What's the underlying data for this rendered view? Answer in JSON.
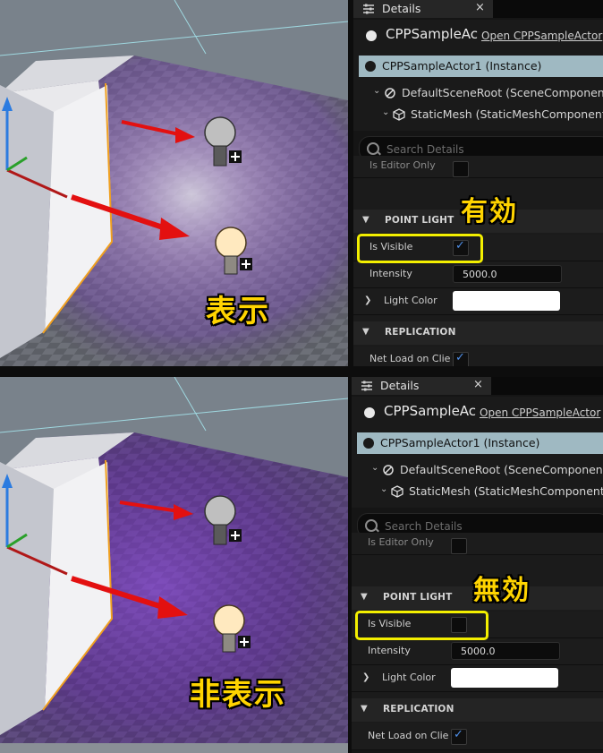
{
  "top": {
    "viewport_annotation": "表示",
    "panel_annotation": "有効",
    "light_bright": true
  },
  "bottom": {
    "viewport_annotation": "非表示",
    "panel_annotation": "無効",
    "light_bright": false
  },
  "details": {
    "tab_label": "Details",
    "tab_close": "×",
    "actor_name": "CPPSampleAc",
    "open_link": "Open CPPSampleActor",
    "instance_label": "CPPSampleActor1 (Instance)",
    "default_scene_root": "DefaultSceneRoot (SceneComponent) (I",
    "static_mesh": "StaticMesh (StaticMeshComponent) (I",
    "search_placeholder": "Search Details",
    "editor_only_label": "Is Editor Only",
    "point_light_section": "POINT LIGHT",
    "is_visible_label": "Is Visible",
    "intensity_label": "Intensity",
    "intensity_value": "5000.0",
    "light_color_label": "Light Color",
    "light_color": "#ffffff",
    "replication_section": "REPLICATION",
    "net_load_label": "Net Load on Clie"
  },
  "is_visible_checked": {
    "top": true,
    "bottom": false
  },
  "net_load_checked": true,
  "colors": {
    "highlight": "#f3ef00",
    "annotation": "#ffd400",
    "arrow": "#e31010",
    "selection": "#9fb9c2",
    "check": "#4f8fe8"
  },
  "icons": [
    "details-icon",
    "actor-sphere-icon",
    "scene-root-icon",
    "static-mesh-icon",
    "search-icon",
    "bulb-icon",
    "gizmo-icon"
  ]
}
